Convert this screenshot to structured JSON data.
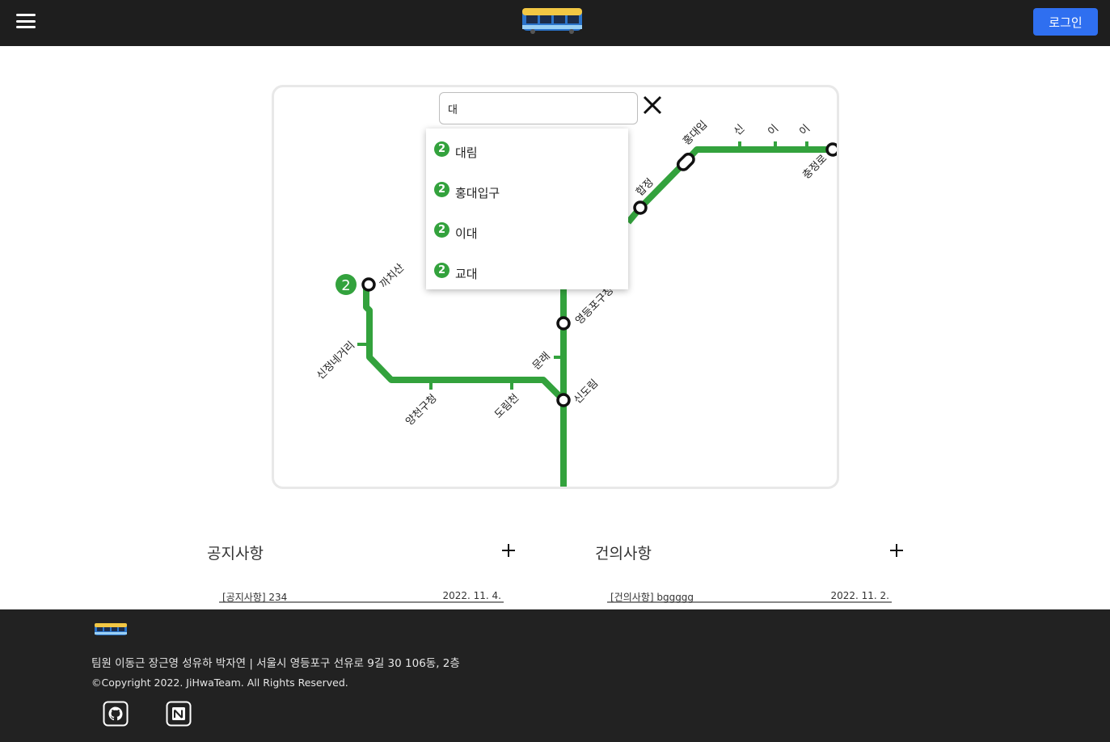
{
  "header": {
    "menu_icon": "hamburger-icon",
    "logo_icon": "subway-train-icon",
    "login_label": "로그인",
    "login_color": "#2f6ff0",
    "background": "#1e1e1e"
  },
  "map": {
    "line_color": "#33a23d",
    "line_badge": "2",
    "stations": [
      "까치산",
      "신정네거리",
      "양천구청",
      "도림천",
      "문래",
      "신도림",
      "영등포구청",
      "합정",
      "홍대입",
      "신",
      "이",
      "이",
      "충정로"
    ]
  },
  "search": {
    "value": "대",
    "close_icon": "close-icon",
    "results": [
      {
        "line": "2",
        "label": "대림"
      },
      {
        "line": "2",
        "label": "홍대입구"
      },
      {
        "line": "2",
        "label": "이대"
      },
      {
        "line": "2",
        "label": "교대"
      }
    ]
  },
  "notice": {
    "title": "공지사항",
    "add_icon": "plus-icon",
    "rows": [
      {
        "title": "[공지사항] 234",
        "date": "2022. 11. 4."
      }
    ]
  },
  "suggestion": {
    "title": "건의사항",
    "add_icon": "plus-icon",
    "rows": [
      {
        "title": "[건의사항] bggggg",
        "date": "2022. 11. 2."
      }
    ]
  },
  "footer": {
    "logo_icon": "subway-train-icon",
    "info": "팀원 이동근 장근영 성유하 박자연 | 서울시 영등포구 선유로 9길 30 106동, 2층",
    "copyright": "©Copyright 2022. JiHwaTeam. All Rights Reserved.",
    "github_icon": "github-icon",
    "notion_icon": "notion-icon"
  }
}
